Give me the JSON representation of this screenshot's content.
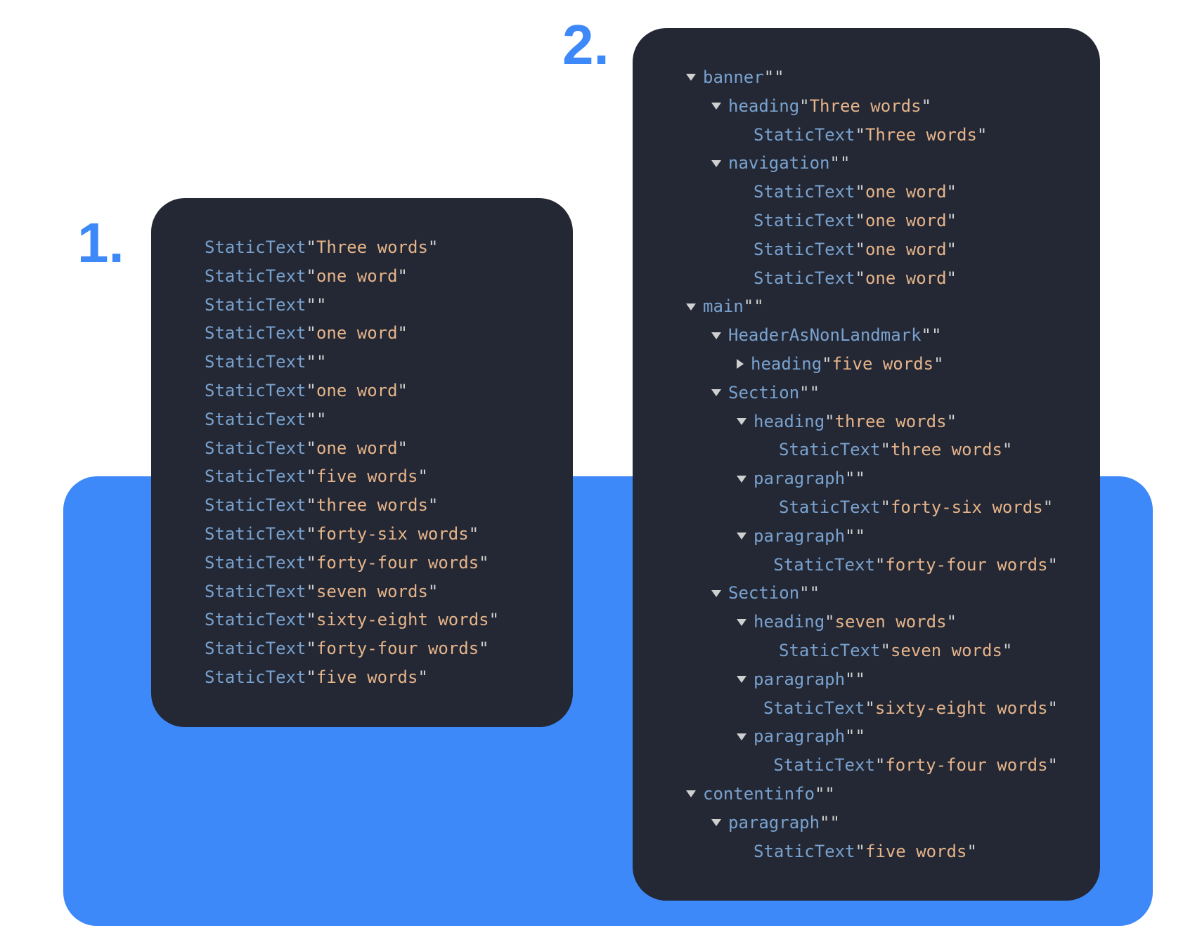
{
  "labels": {
    "one": "1.",
    "two": "2."
  },
  "tokens": {
    "StaticText": "StaticText",
    "banner": "banner",
    "heading": "heading",
    "navigation": "navigation",
    "main": "main",
    "HeaderAsNonLandmark": "HeaderAsNonLandmark",
    "Section": "Section",
    "paragraph": "paragraph",
    "contentinfo": "contentinfo"
  },
  "q": "\"",
  "strings": {
    "three_words_cap": "Three words",
    "one_word": "one word",
    "empty": "",
    "five_words": "five words",
    "three_words": "three words",
    "forty_six": "forty-six words",
    "forty_four": "forty-four words",
    "seven_words": "seven words",
    "sixty_eight": "sixty-eight words"
  },
  "panel1": [
    {
      "val": "three_words_cap"
    },
    {
      "val": "one_word"
    },
    {
      "val": "empty"
    },
    {
      "val": "one_word"
    },
    {
      "val": "empty"
    },
    {
      "val": "one_word"
    },
    {
      "val": "empty"
    },
    {
      "val": "one_word"
    },
    {
      "val": "five_words"
    },
    {
      "val": "three_words"
    },
    {
      "val": "forty_six"
    },
    {
      "val": "forty_four"
    },
    {
      "val": "seven_words"
    },
    {
      "val": "sixty_eight"
    },
    {
      "val": "forty_four"
    },
    {
      "val": "five_words"
    }
  ],
  "panel2": [
    {
      "indent": 1,
      "arrow": "down",
      "node": "banner",
      "val": "empty"
    },
    {
      "indent": 2,
      "arrow": "down",
      "node": "heading",
      "val": "three_words_cap"
    },
    {
      "indent": 3,
      "arrow": null,
      "node": "StaticText",
      "val": "three_words_cap"
    },
    {
      "indent": 2,
      "arrow": "down",
      "node": "navigation",
      "val": "empty"
    },
    {
      "indent": 3,
      "arrow": null,
      "node": "StaticText",
      "val": "one_word"
    },
    {
      "indent": 3,
      "arrow": null,
      "node": "StaticText",
      "val": "one_word"
    },
    {
      "indent": 3,
      "arrow": null,
      "node": "StaticText",
      "val": "one_word"
    },
    {
      "indent": 3,
      "arrow": null,
      "node": "StaticText",
      "val": "one_word"
    },
    {
      "indent": 1,
      "arrow": "down",
      "node": "main",
      "val": "empty"
    },
    {
      "indent": 2,
      "arrow": "down",
      "node": "HeaderAsNonLandmark",
      "val": "empty"
    },
    {
      "indent": 3,
      "arrow": "right",
      "node": "heading",
      "val": "five_words"
    },
    {
      "indent": 2,
      "arrow": "down",
      "node": "Section",
      "val": "empty"
    },
    {
      "indent": 3,
      "arrow": "down",
      "node": "heading",
      "val": "three_words"
    },
    {
      "indent": 4,
      "arrow": null,
      "node": "StaticText",
      "val": "three_words"
    },
    {
      "indent": 3,
      "arrow": "down",
      "node": "paragraph",
      "val": "empty"
    },
    {
      "indent": 4,
      "arrow": null,
      "node": "StaticText",
      "val": "forty_six"
    },
    {
      "indent": 3,
      "arrow": "down",
      "node": "paragraph",
      "val": "empty"
    },
    {
      "indent": 4,
      "arrow": null,
      "node": "StaticText",
      "val": "forty_four"
    },
    {
      "indent": 2,
      "arrow": "down",
      "node": "Section",
      "val": "empty"
    },
    {
      "indent": 3,
      "arrow": "down",
      "node": "heading",
      "val": "seven_words"
    },
    {
      "indent": 4,
      "arrow": null,
      "node": "StaticText",
      "val": "seven_words"
    },
    {
      "indent": 3,
      "arrow": "down",
      "node": "paragraph",
      "val": "empty"
    },
    {
      "indent": 4,
      "arrow": null,
      "node": "StaticText",
      "val": "sixty_eight"
    },
    {
      "indent": 3,
      "arrow": "down",
      "node": "paragraph",
      "val": "empty"
    },
    {
      "indent": 4,
      "arrow": null,
      "node": "StaticText",
      "val": "forty_four"
    },
    {
      "indent": 1,
      "arrow": "down",
      "node": "contentinfo",
      "val": "empty"
    },
    {
      "indent": 2,
      "arrow": "down",
      "node": "paragraph",
      "val": "empty"
    },
    {
      "indent": 3,
      "arrow": null,
      "node": "StaticText",
      "val": "five_words"
    }
  ]
}
